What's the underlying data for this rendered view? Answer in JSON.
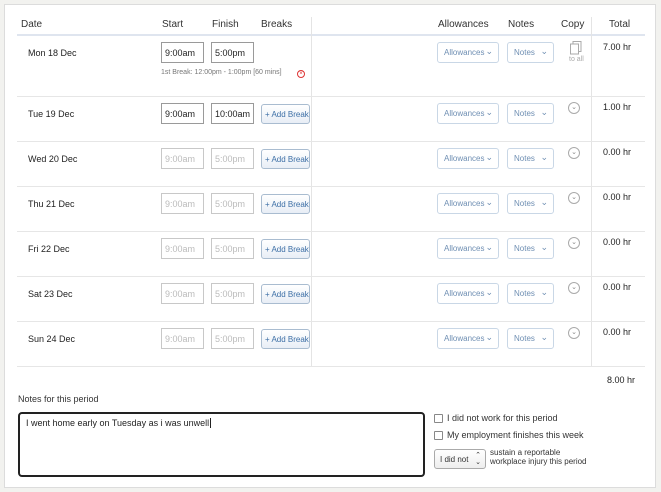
{
  "headers": {
    "date": "Date",
    "start": "Start",
    "finish": "Finish",
    "breaks": "Breaks",
    "allowances": "Allowances",
    "notes": "Notes",
    "copy": "Copy",
    "total": "Total"
  },
  "rows": [
    {
      "date": "Mon 18 Dec",
      "start": "9:00am",
      "finish": "5:00pm",
      "break_info": "1st Break: 12:00pm - 1:00pm [60 mins]",
      "allowances": "Allowances",
      "notes": "Notes",
      "copy_label": "to all",
      "total": "7.00 hr"
    },
    {
      "date": "Tue 19 Dec",
      "start": "9:00am",
      "finish": "10:00am",
      "add_break": "+ Add Break",
      "allowances": "Allowances",
      "notes": "Notes",
      "total": "1.00 hr"
    },
    {
      "date": "Wed 20 Dec",
      "start": "9:00am",
      "finish": "5:00pm",
      "add_break": "+ Add Break",
      "allowances": "Allowances",
      "notes": "Notes",
      "total": "0.00 hr"
    },
    {
      "date": "Thu 21 Dec",
      "start": "9:00am",
      "finish": "5:00pm",
      "add_break": "+ Add Break",
      "allowances": "Allowances",
      "notes": "Notes",
      "total": "0.00 hr"
    },
    {
      "date": "Fri 22 Dec",
      "start": "9:00am",
      "finish": "5:00pm",
      "add_break": "+ Add Break",
      "allowances": "Allowances",
      "notes": "Notes",
      "total": "0.00 hr"
    },
    {
      "date": "Sat 23 Dec",
      "start": "9:00am",
      "finish": "5:00pm",
      "add_break": "+ Add Break",
      "allowances": "Allowances",
      "notes": "Notes",
      "total": "0.00 hr"
    },
    {
      "date": "Sun 24 Dec",
      "start": "9:00am",
      "finish": "5:00pm",
      "add_break": "+ Add Break",
      "allowances": "Allowances",
      "notes": "Notes",
      "total": "0.00 hr"
    }
  ],
  "grand_total": "8.00",
  "grand_total_unit": "hr",
  "notes_section": {
    "label": "Notes for this period",
    "value": "I went home early on Tuesday as i was unwell"
  },
  "options": {
    "did_not_work": "I did not work for this period",
    "employment_finishes": "My employment finishes this week",
    "injury_select": "I did not",
    "injury_text_line1": "sustain a reportable",
    "injury_text_line2": "workplace injury this period"
  },
  "icons": {
    "dropdown": "chevron-down-icon",
    "copy": "copy-icon",
    "copy_row": "circle-chevron-down-icon",
    "remove_break": "remove-circle-icon"
  }
}
